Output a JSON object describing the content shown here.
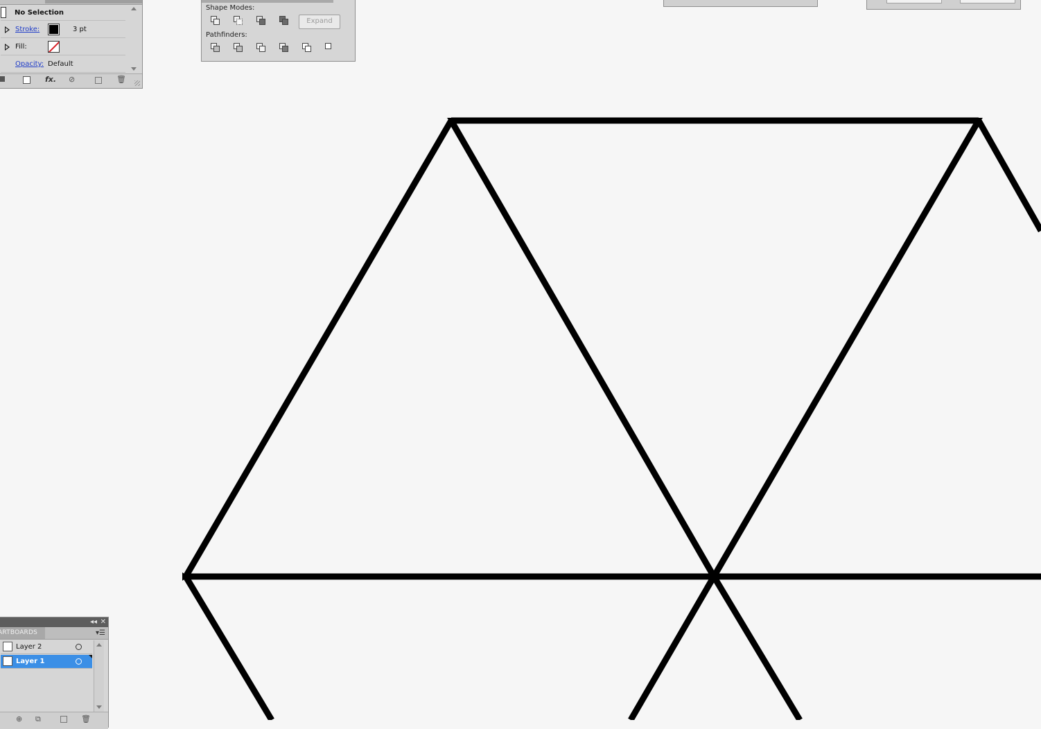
{
  "appearance": {
    "selection_label": "No Selection",
    "stroke_label": "Stroke:",
    "stroke_value": "3 pt",
    "fill_label": "Fill:",
    "opacity_label": "Opacity:",
    "opacity_value": "Default",
    "fx_label": "fx."
  },
  "pathfinder": {
    "shape_modes_label": "Shape Modes:",
    "expand_label": "Expand",
    "pathfinders_label": "Pathfinders:"
  },
  "layers": {
    "tab_label": "ARTBOARDS",
    "items": [
      {
        "label": "Layer 2",
        "selected": false
      },
      {
        "label": "Layer 1",
        "selected": true
      }
    ]
  },
  "colors": {
    "canvas_bg": "#f6f6f6",
    "stroke_color": "#000000",
    "selection_blue": "#3b8fe6",
    "link_blue": "#1f3cc8"
  },
  "icons": [
    "stroke-disclosure-icon",
    "fill-disclosure-icon",
    "fx-icon",
    "clear-appearance-icon",
    "duplicate-item-icon",
    "delete-item-icon",
    "collapse-panel-icon",
    "close-panel-icon",
    "panel-menu-icon",
    "target-icon"
  ]
}
